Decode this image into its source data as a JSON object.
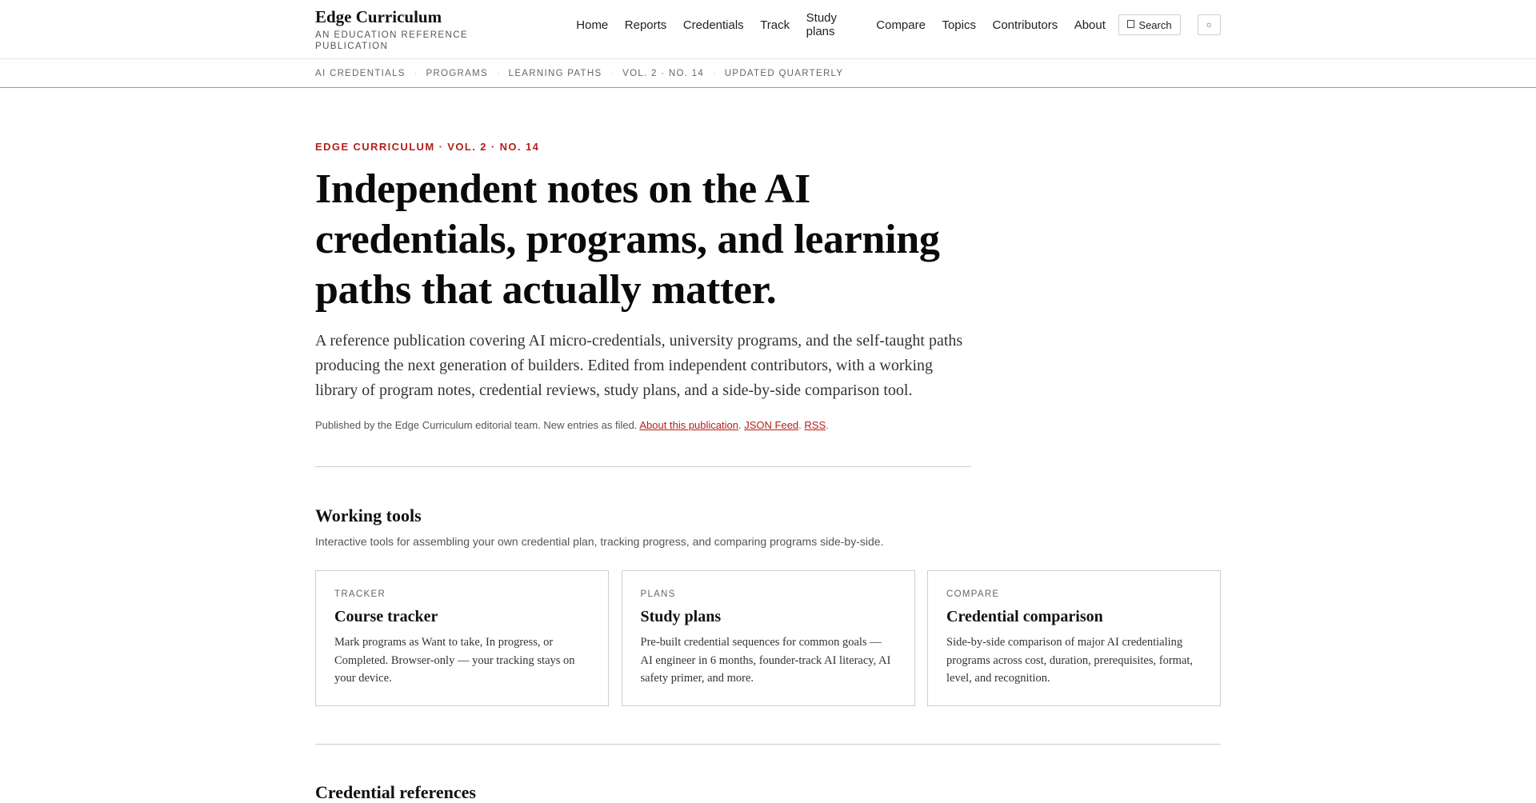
{
  "header": {
    "brand_name": "Edge Curriculum",
    "brand_sub": "AN EDUCATION REFERENCE PUBLICATION",
    "nav": [
      "Home",
      "Reports",
      "Credentials",
      "Track",
      "Study plans",
      "Compare",
      "Topics",
      "Contributors",
      "About"
    ],
    "search_label": "Search",
    "search_icon": "search-icon",
    "theme_icon": "sun-icon",
    "theme_glyph": "☼"
  },
  "subbar": {
    "crumbs": [
      "AI CREDENTIALS",
      "PROGRAMS",
      "LEARNING PATHS",
      "VOL. 2 · NO. 14",
      "UPDATED QUARTERLY"
    ]
  },
  "hero": {
    "eyebrow": "EDGE CURRICULUM · VOL. 2 · NO. 14",
    "title": "Independent notes on the AI credentials, programs, and learning paths that actually matter.",
    "lede": "A reference publication covering AI micro-credentials, university programs, and the self-taught paths producing the next generation of builders. Edited from independent contributors, with a working library of program notes, credential reviews, study plans, and a side-by-side comparison tool.",
    "byline_text": "Published by the Edge Curriculum editorial team. New entries as filed.",
    "byline_links": [
      "About this publication",
      "JSON Feed",
      "RSS"
    ]
  },
  "tools": {
    "title": "Working tools",
    "subtitle": "Interactive tools for assembling your own credential plan, tracking progress, and comparing programs side-by-side.",
    "cards": [
      {
        "kicker": "TRACKER",
        "title": "Course tracker",
        "desc": "Mark programs as Want to take, In progress, or Completed. Browser-only — your tracking stays on your device."
      },
      {
        "kicker": "PLANS",
        "title": "Study plans",
        "desc": "Pre-built credential sequences for common goals — AI engineer in 6 months, founder-track AI literacy, AI safety primer, and more."
      },
      {
        "kicker": "COMPARE",
        "title": "Credential comparison",
        "desc": "Side-by-side comparison of major AI credentialing programs across cost, duration, prerequisites, format, level, and recognition."
      }
    ]
  },
  "next_section": {
    "title": "Credential references"
  },
  "colors": {
    "accent": "#b3201b",
    "text": "#111111",
    "muted": "#555555",
    "border": "#cfcfcf"
  }
}
